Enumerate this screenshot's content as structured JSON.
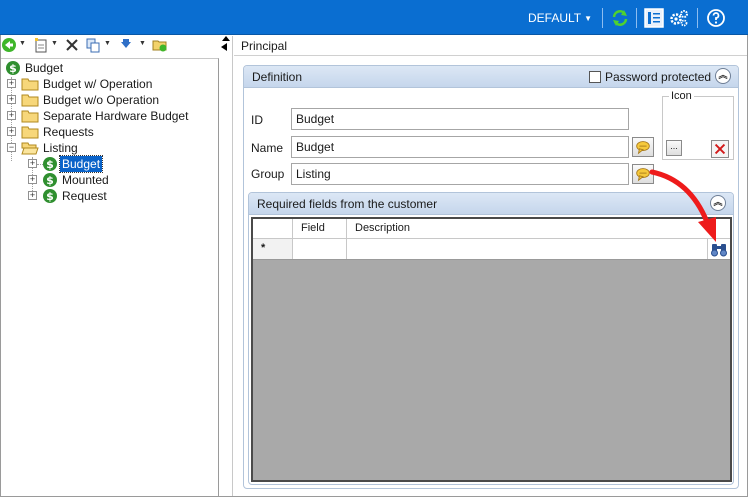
{
  "topbar": {
    "profile_label": "DEFAULT",
    "accent": "#0a6ed1"
  },
  "left_toolbar": {
    "icons": [
      "back-icon",
      "new-document-icon",
      "delete-icon",
      "copy-icon",
      "move-down-icon",
      "folder-refresh-icon"
    ]
  },
  "tree": {
    "root": {
      "label": "Budget"
    },
    "items": [
      {
        "label": "Budget w/ Operation"
      },
      {
        "label": "Budget w/o Operation"
      },
      {
        "label": "Separate Hardware Budget"
      },
      {
        "label": "Requests"
      },
      {
        "label": "Listing"
      }
    ],
    "children": [
      {
        "label": "Budget",
        "selected": true
      },
      {
        "label": "Mounted",
        "selected": false
      },
      {
        "label": "Request",
        "selected": false
      }
    ]
  },
  "tab": {
    "label": "Principal"
  },
  "definition": {
    "title": "Definition",
    "password_protected_label": "Password protected",
    "password_protected": false,
    "id_label": "ID",
    "id_value": "Budget",
    "name_label": "Name",
    "name_value": "Budget",
    "group_label": "Group",
    "group_value": "Listing",
    "icon_label": "Icon",
    "icon_browse_label": "..."
  },
  "required_fields": {
    "title": "Required fields from the customer",
    "columns": [
      "Field",
      "Description"
    ],
    "new_row_marker": "*"
  }
}
